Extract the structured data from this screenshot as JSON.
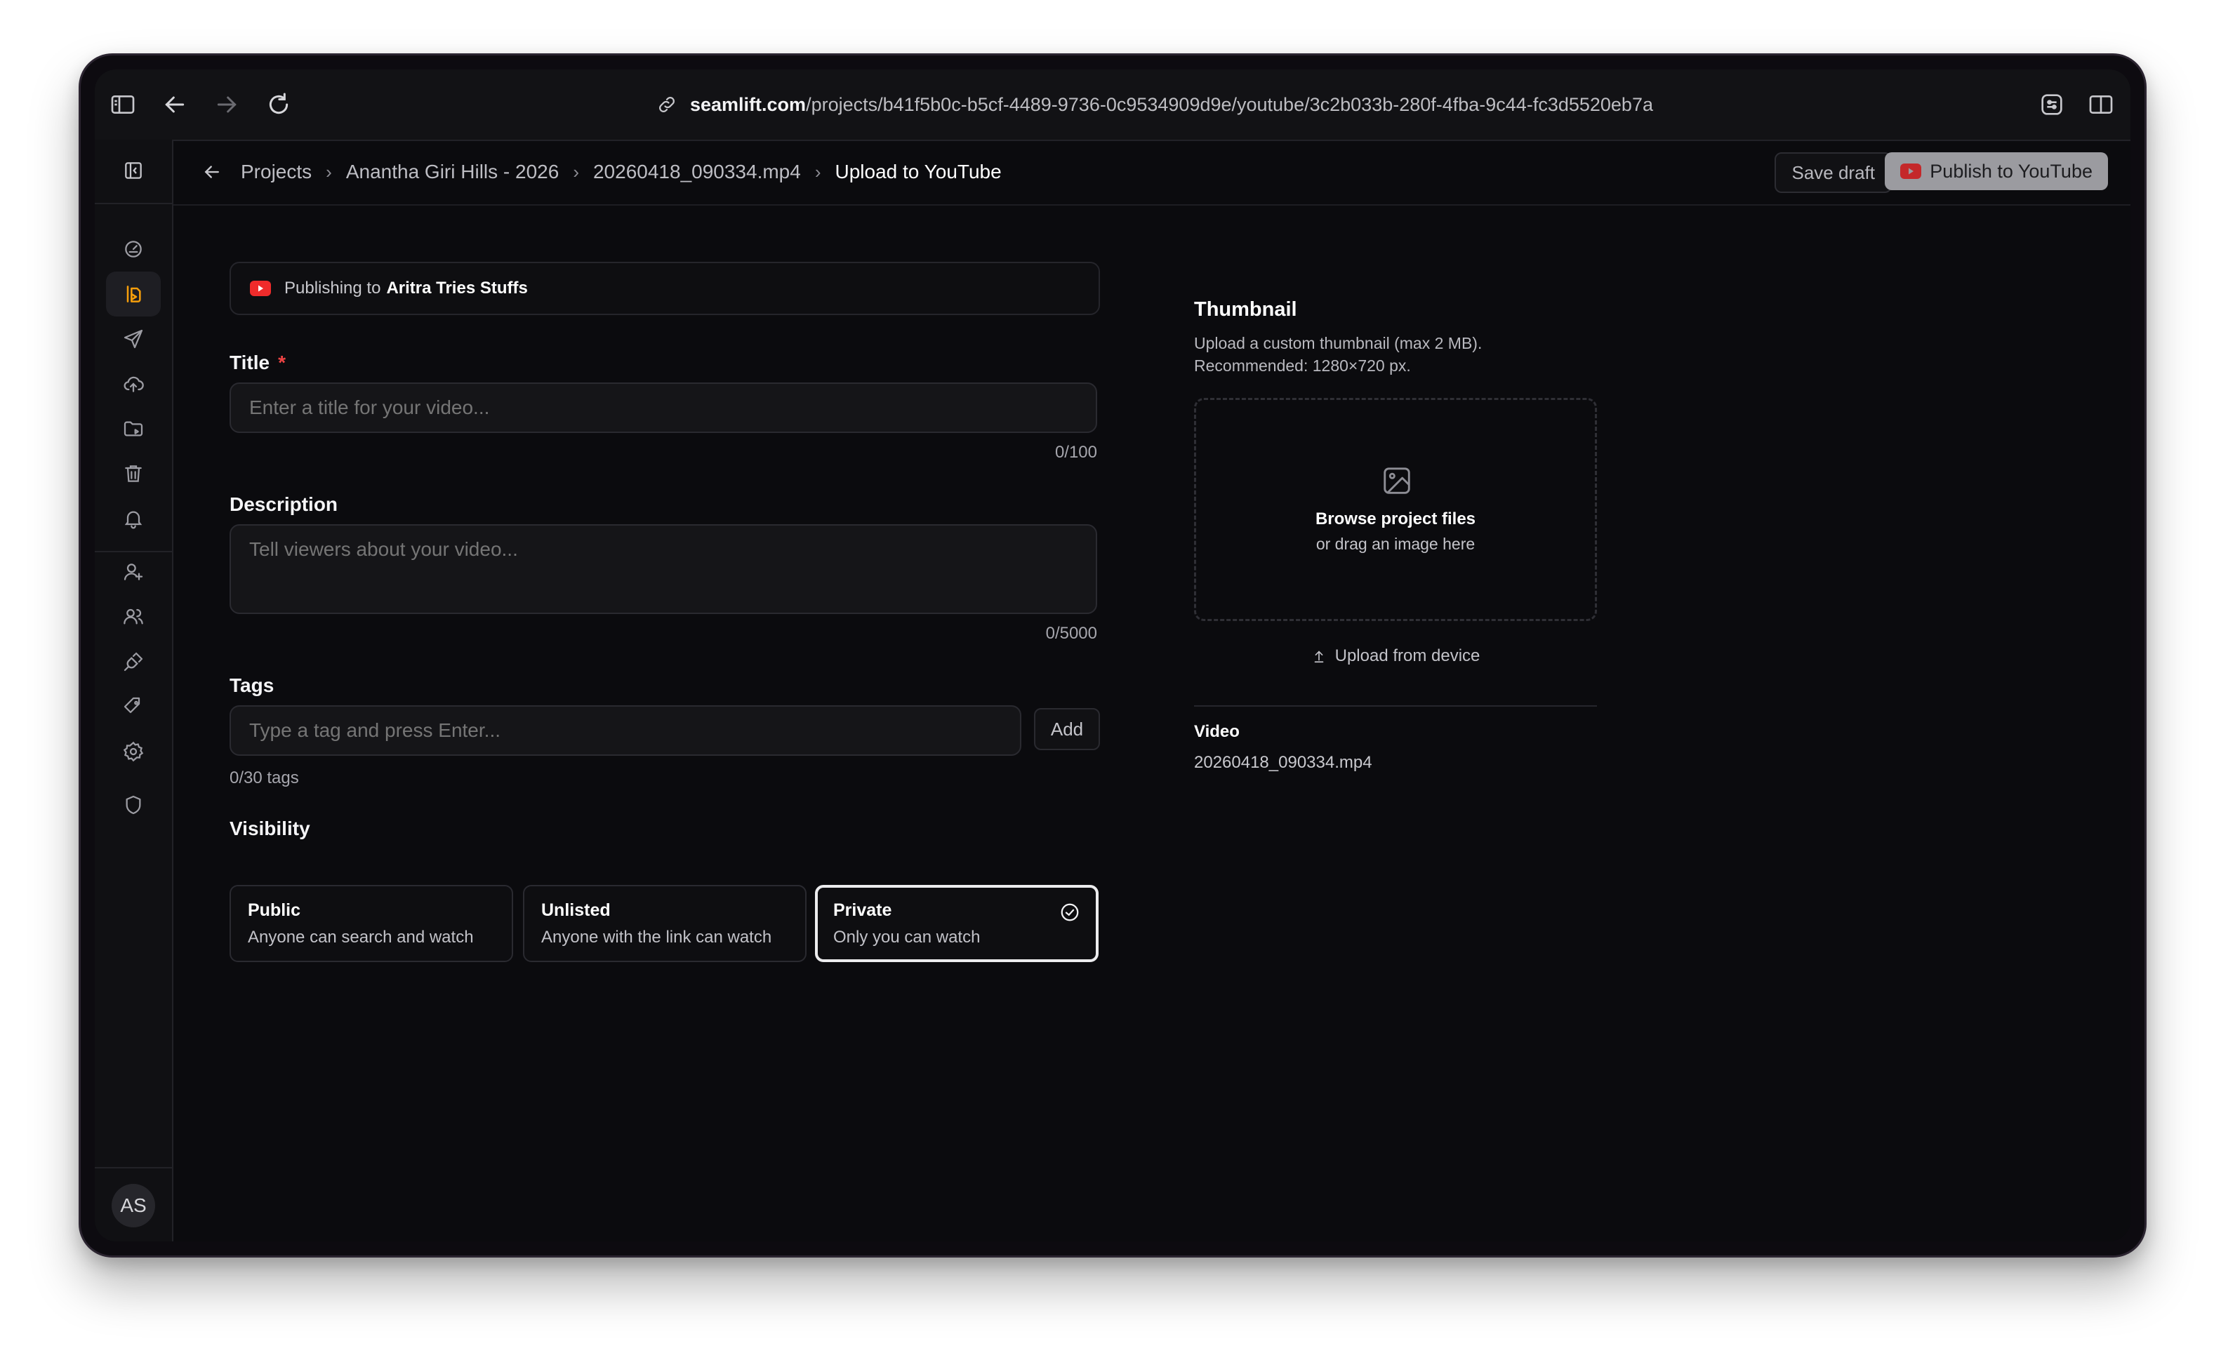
{
  "browser": {
    "url_host": "seamlift.com",
    "url_path": "/projects/b41f5b0c-b5cf-4489-9736-0c9534909d9e/youtube/3c2b033b-280f-4fba-9c44-fc3d5520eb7a"
  },
  "sidebar": {
    "avatar_initials": "AS"
  },
  "header": {
    "breadcrumbs": [
      "Projects",
      "Anantha Giri Hills - 2026",
      "20260418_090334.mp4",
      "Upload to YouTube"
    ],
    "save_draft": "Save draft",
    "publish": "Publish to YouTube"
  },
  "form": {
    "publishing_prefix": "Publishing to",
    "channel": "Aritra Tries Stuffs",
    "title_label": "Title",
    "required_mark": "*",
    "title_placeholder": "Enter a title for your video...",
    "title_counter": "0/100",
    "description_label": "Description",
    "description_placeholder": "Tell viewers about your video...",
    "description_counter": "0/5000",
    "tags_label": "Tags",
    "tags_placeholder": "Type a tag and press Enter...",
    "tags_add": "Add",
    "tags_counter": "0/30 tags",
    "visibility_label": "Visibility",
    "visibility": [
      {
        "title": "Public",
        "desc": "Anyone can search and watch"
      },
      {
        "title": "Unlisted",
        "desc": "Anyone with the link can watch"
      },
      {
        "title": "Private",
        "desc": "Only you can watch"
      }
    ],
    "visibility_selected": "Private"
  },
  "thumbnail": {
    "title": "Thumbnail",
    "desc_line1": "Upload a custom thumbnail (max 2 MB).",
    "desc_line2": "Recommended: 1280×720 px.",
    "browse": "Browse project files",
    "drag": "or drag an image here",
    "upload_device": "Upload from device"
  },
  "video": {
    "label": "Video",
    "filename": "20260418_090334.mp4"
  },
  "colors": {
    "accent_orange": "#f59e0b",
    "youtube_red": "#ef2b2b",
    "required_red": "#ef4444"
  }
}
